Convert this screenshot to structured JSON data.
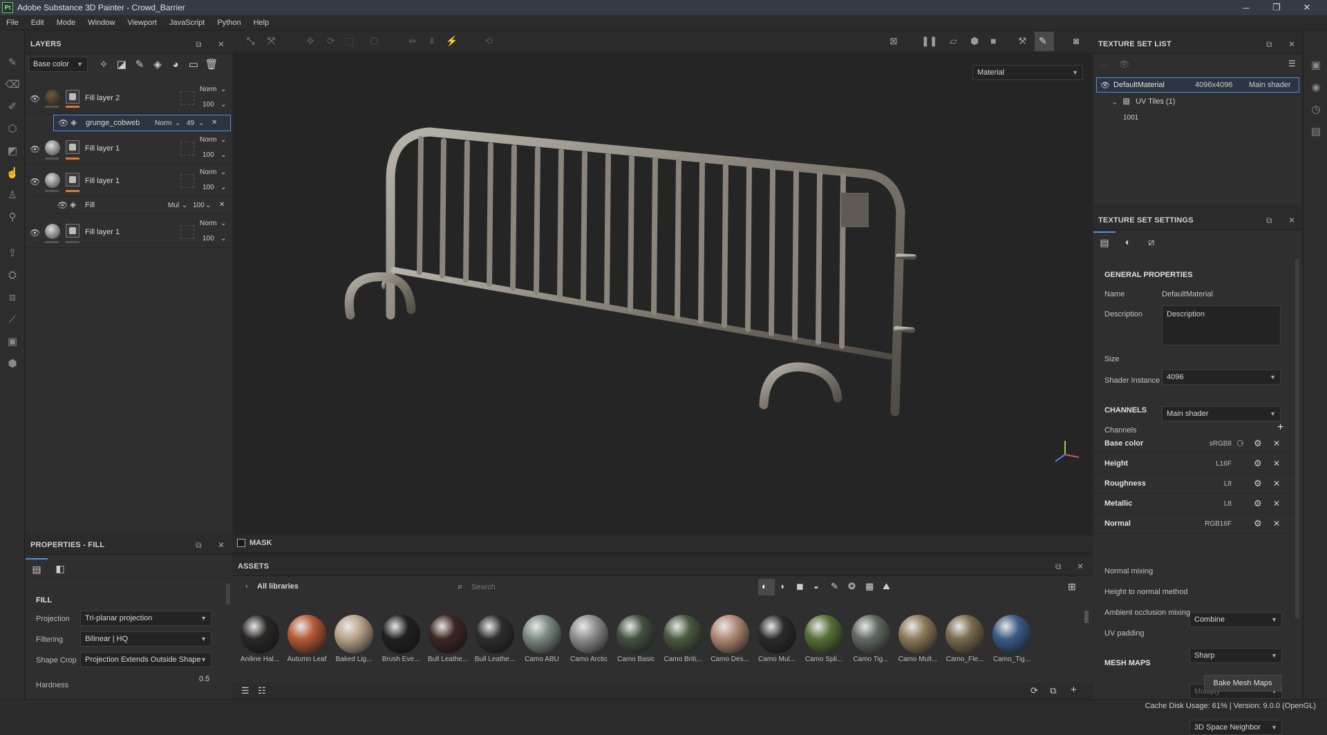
{
  "titlebar": {
    "app_logo": "Pt",
    "title": "Adobe Substance 3D Painter - Crowd_Barrier",
    "minimize": "─",
    "restore": "❐",
    "close": "✕"
  },
  "menu": [
    "File",
    "Edit",
    "Mode",
    "Window",
    "Viewport",
    "JavaScript",
    "Python",
    "Help"
  ],
  "layers": {
    "title": "LAYERS",
    "channel": "Base color",
    "items": [
      {
        "name": "Fill layer 2",
        "blend": "Norm",
        "opacity": "100"
      },
      {
        "name": "grunge_cobweb",
        "blend": "Norm",
        "opacity": "49"
      },
      {
        "name": "Fill layer 1",
        "blend": "Norm",
        "opacity": "100"
      },
      {
        "name": "Fill layer 1",
        "blend": "Norm",
        "opacity": "100"
      },
      {
        "name": "Fill",
        "blend": "Mul",
        "opacity": "100"
      },
      {
        "name": "Fill layer 1",
        "blend": "Norm",
        "opacity": "100"
      }
    ]
  },
  "properties": {
    "title": "PROPERTIES - FILL",
    "section": "FILL",
    "projection_label": "Projection",
    "projection": "Tri-planar projection",
    "filtering_label": "Filtering",
    "filtering": "Bilinear | HQ",
    "shape_crop_label": "Shape Crop",
    "shape_crop": "Projection Extends Outside Shape",
    "hardness_label": "Hardness",
    "hardness": "0.5"
  },
  "viewport": {
    "display_mode": "Material",
    "mask_label": "MASK"
  },
  "assets": {
    "title": "ASSETS",
    "library": "All libraries",
    "search_placeholder": "Search",
    "materials": [
      {
        "name": "Aniline Hal...",
        "color": "#2a2625"
      },
      {
        "name": "Autumn Leaf",
        "color": "#b85a35"
      },
      {
        "name": "Baked Lig...",
        "color": "#b9a48a"
      },
      {
        "name": "Brush Eve...",
        "color": "#202022"
      },
      {
        "name": "Bull Leathe...",
        "color": "#3c2523"
      },
      {
        "name": "Bull Leathe...",
        "color": "#2c2c2c"
      },
      {
        "name": "Camo ABU",
        "color": "#7c8a80"
      },
      {
        "name": "Camo Arctic",
        "color": "#8f8f8f"
      },
      {
        "name": "Camo Basic",
        "color": "#445041"
      },
      {
        "name": "Camo Briti...",
        "color": "#4b5a3f"
      },
      {
        "name": "Camo Des...",
        "color": "#b28974"
      },
      {
        "name": "Camo Mul...",
        "color": "#2a2a2a"
      },
      {
        "name": "Camo Spli...",
        "color": "#566f37"
      },
      {
        "name": "Camo Tig...",
        "color": "#606a60"
      },
      {
        "name": "Camo Mult...",
        "color": "#8d7a58"
      },
      {
        "name": "Camo_Fle...",
        "color": "#7a6b4e"
      },
      {
        "name": "Camo_Tig...",
        "color": "#3b5c86"
      }
    ]
  },
  "texture_set_list": {
    "title": "TEXTURE SET LIST",
    "material": "DefaultMaterial",
    "resolution": "4096x4096",
    "shader": "Main shader",
    "uv_tiles": "UV Tiles (1)",
    "tile": "1001"
  },
  "texture_set_settings": {
    "title": "TEXTURE SET SETTINGS",
    "general": "GENERAL PROPERTIES",
    "name_label": "Name",
    "name": "DefaultMaterial",
    "desc_label": "Description",
    "desc_placeholder": "Description",
    "size_label": "Size",
    "size": "4096",
    "shader_label": "Shader Instance",
    "shader": "Main shader",
    "channels_header": "CHANNELS",
    "channels_label": "Channels",
    "channels": [
      {
        "name": "Base color",
        "format": "sRGB8"
      },
      {
        "name": "Height",
        "format": "L16F"
      },
      {
        "name": "Roughness",
        "format": "L8"
      },
      {
        "name": "Metallic",
        "format": "L8"
      },
      {
        "name": "Normal",
        "format": "RGB16F"
      }
    ],
    "normal_mixing_label": "Normal mixing",
    "normal_mixing": "Combine",
    "htn_label": "Height to normal method",
    "htn": "Sharp",
    "ao_label": "Ambient occlusion mixing",
    "ao": "Multiply",
    "uvpad_label": "UV padding",
    "uvpad": "3D Space Neighbor",
    "mesh_maps": "MESH MAPS",
    "bake_button": "Bake Mesh Maps"
  },
  "status": "Cache Disk Usage:   61% | Version: 9.0.0 (OpenGL)"
}
